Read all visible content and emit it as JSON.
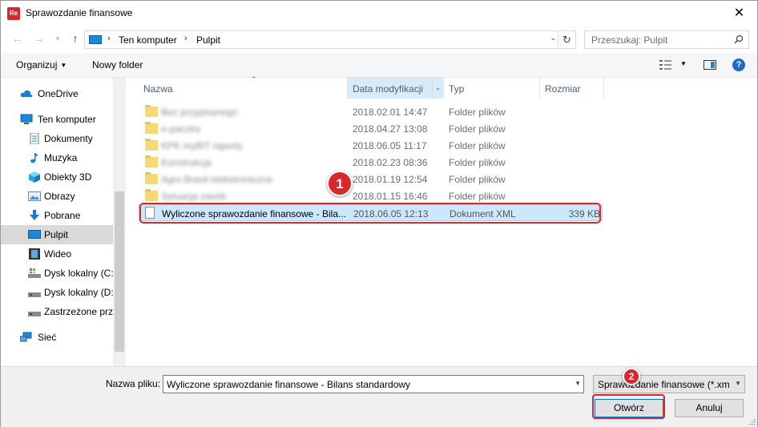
{
  "window": {
    "title": "Sprawozdanie finansowe",
    "app_icon_text": "Re"
  },
  "nav": {
    "crumbs": [
      "Ten komputer",
      "Pulpit"
    ],
    "search_placeholder": "Przeszukaj: Pulpit"
  },
  "toolbar": {
    "organize": "Organizuj",
    "new_folder": "Nowy folder"
  },
  "sidebar": {
    "items": [
      {
        "label": "OneDrive",
        "icon": "cloud-icon"
      },
      {
        "label": "Ten komputer",
        "icon": "computer-icon"
      },
      {
        "label": "Dokumenty",
        "icon": "documents-icon"
      },
      {
        "label": "Muzyka",
        "icon": "music-icon"
      },
      {
        "label": "Obiekty 3D",
        "icon": "cube-icon"
      },
      {
        "label": "Obrazy",
        "icon": "pictures-icon"
      },
      {
        "label": "Pobrane",
        "icon": "download-icon"
      },
      {
        "label": "Pulpit",
        "icon": "desktop-icon"
      },
      {
        "label": "Wideo",
        "icon": "video-icon"
      },
      {
        "label": "Dysk lokalny (C:)",
        "icon": "drive-c-icon"
      },
      {
        "label": "Dysk lokalny (D:)",
        "icon": "drive-d-icon"
      },
      {
        "label": "Zastrzeżone przestrzenie",
        "icon": "reserved-drive-icon"
      },
      {
        "label": "Sieć",
        "icon": "network-icon"
      }
    ]
  },
  "columns": {
    "name": "Nazwa",
    "date": "Data modyfikacji",
    "type": "Typ",
    "size": "Rozmiar"
  },
  "files": [
    {
      "name": "Bez przypisanego",
      "date": "2018.02.01 14:47",
      "type": "Folder plików",
      "size": ""
    },
    {
      "name": "e-paczka",
      "date": "2018.04.27 13:08",
      "type": "Folder plików",
      "size": ""
    },
    {
      "name": "KPK myBiT raporty",
      "date": "2018.06.05 11:17",
      "type": "Folder plików",
      "size": ""
    },
    {
      "name": "Konstrukcja",
      "date": "2018.02.23 08:36",
      "type": "Folder plików",
      "size": ""
    },
    {
      "name": "Agro Brasil eleketroniczne",
      "date": "2018.01.19 12:54",
      "type": "Folder plików",
      "size": ""
    },
    {
      "name": "Sytuacja zasób",
      "date": "2018.01.15 16:46",
      "type": "Folder plików",
      "size": ""
    },
    {
      "name": "Wyliczone sprawozdanie finansowe - Bila...",
      "date": "2018.06.05 12:13",
      "type": "Dokument XML",
      "size": "339 KB"
    }
  ],
  "markers": {
    "step1": "1",
    "step2": "2"
  },
  "bottom": {
    "filename_label": "Nazwa pliku:",
    "filename_value": "Wyliczone sprawozdanie finansowe - Bilans standardowy",
    "filter_value": "Sprawozdanie finansowe (*.xml",
    "open_label": "Otwórz",
    "cancel_label": "Anuluj"
  },
  "colors": {
    "accent": "#0078d7",
    "highlight": "#d8282c",
    "selection": "#cce8ff"
  }
}
